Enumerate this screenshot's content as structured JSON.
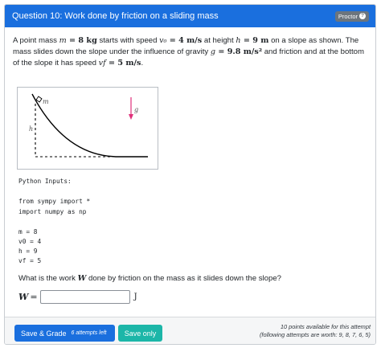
{
  "header": {
    "title": "Question 10: Work done by friction on a sliding mass",
    "proctor_label": "Proctor",
    "help_glyph": "?"
  },
  "statement": {
    "p1": "A point mass ",
    "m_sym": "m",
    "m_val": " = 8 kg",
    "p2": " starts with speed ",
    "v0_sym": "v₀",
    "v0_val": " = 4 m/s",
    "p3": " at height ",
    "h_sym": "h",
    "h_val": " = 9 m",
    "p4": " on a slope as shown. The mass slides down the slope under the influence of gravity ",
    "g_sym": "g",
    "g_val": " = 9.8 m/s²",
    "p5": " and friction and at the bottom of the slope it has speed ",
    "vf_sym": "vf",
    "vf_val": " = 5 m/s",
    "p6": "."
  },
  "figure": {
    "mass_label": "m",
    "height_label": "h",
    "gravity_label": "g",
    "curve_color": "#000000",
    "arrow_color": "#e0307a"
  },
  "code": {
    "heading": "Python Inputs:",
    "import1": "from sympy import *",
    "import2": "import numpy as np",
    "line_m": "m = 8",
    "line_v0": "v0 = 4",
    "line_h": "h = 9",
    "line_vf": "vf = 5"
  },
  "question": {
    "p1": "What is the work ",
    "w_sym": "W",
    "p2": " done by friction on the mass as it slides down the slope?"
  },
  "answer": {
    "label": "W",
    "equals": "=",
    "value": "",
    "unit": "J"
  },
  "footer": {
    "grade_label": "Save & Grade",
    "attempts_label": "6 attempts left",
    "save_label": "Save only",
    "points_line1": "10 points available for this attempt",
    "points_line2": "(following attempts are worth: 9, 8, 7, 6, 5)"
  },
  "colors": {
    "primary": "#1a6fde",
    "teal": "#1cb6a8",
    "badge": "#6c757d"
  }
}
